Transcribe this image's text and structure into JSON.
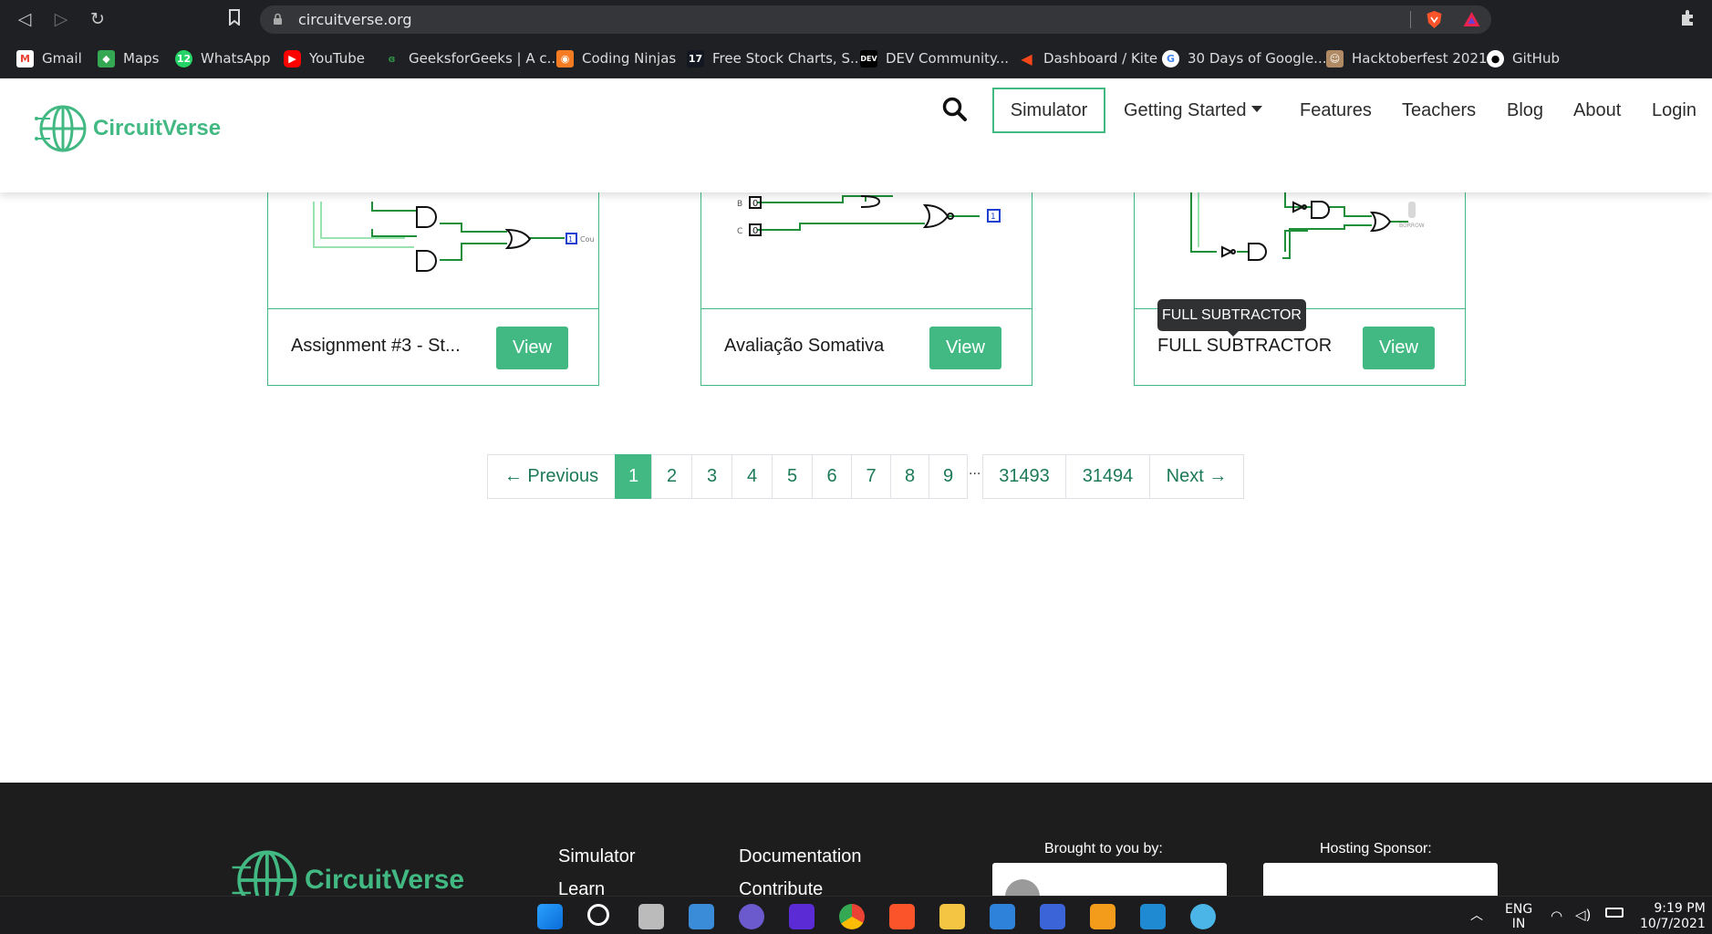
{
  "browser": {
    "url": "circuitverse.org",
    "bookmarks": [
      {
        "label": "Gmail",
        "icon": "gmail-icon",
        "color": "#ea4335"
      },
      {
        "label": "Maps",
        "icon": "maps-icon",
        "color": "#34a853"
      },
      {
        "label": "WhatsApp",
        "icon": "whatsapp-icon",
        "color": "#25d366"
      },
      {
        "label": "YouTube",
        "icon": "youtube-icon",
        "color": "#ff0000"
      },
      {
        "label": "GeeksforGeeks | A c...",
        "icon": "geeksforgeeks-icon",
        "color": "#2f8d46"
      },
      {
        "label": "Coding Ninjas",
        "icon": "codingninjas-icon",
        "color": "#f57c22"
      },
      {
        "label": "Free Stock Charts, S...",
        "icon": "tradingview-icon",
        "color": "#000000"
      },
      {
        "label": "DEV Community...",
        "icon": "dev-icon",
        "color": "#000000"
      },
      {
        "label": "Dashboard / Kite",
        "icon": "kite-icon",
        "color": "#f6461a"
      },
      {
        "label": "30 Days of Google...",
        "icon": "google-icon",
        "color": "#ffffff"
      },
      {
        "label": "Hacktoberfest 2021",
        "icon": "hacktoberfest-icon",
        "color": "#b08a64"
      },
      {
        "label": "GitHub",
        "icon": "github-icon",
        "color": "#ffffff"
      }
    ]
  },
  "site": {
    "brand": "CircuitVerse",
    "brand_color": "#42b983",
    "nav": {
      "simulator": "Simulator",
      "getting_started": "Getting Started",
      "features": "Features",
      "teachers": "Teachers",
      "blog": "Blog",
      "about": "About",
      "login": "Login"
    }
  },
  "cards": [
    {
      "title": "Assignment #3 - St...",
      "view": "View",
      "output_label": "1",
      "side_label": "Cou"
    },
    {
      "title": "Avaliação Somativa",
      "view": "View",
      "input_b": "0",
      "input_c": "0",
      "label_b": "B",
      "label_c": "C",
      "output_label": "1"
    },
    {
      "title": "FULL SUBTRACTOR",
      "view": "View",
      "side_label": "BORROW"
    }
  ],
  "tooltip": "FULL SUBTRACTOR",
  "pagination": {
    "previous": "← Previous",
    "pages": [
      "1",
      "2",
      "3",
      "4",
      "5",
      "6",
      "7",
      "8",
      "9"
    ],
    "active": "1",
    "gap": "...",
    "last_pages": [
      "31493",
      "31494"
    ],
    "next": "Next →"
  },
  "footer": {
    "links_col1": [
      "Simulator",
      "Learn"
    ],
    "links_col2": [
      "Documentation",
      "Contribute"
    ],
    "brought_to_you_by": "Brought to you by:",
    "hosting_sponsor": "Hosting Sponsor:"
  },
  "taskbar": {
    "lang": "ENG",
    "region": "IN",
    "time": "9:19 PM",
    "date": "10/7/2021"
  }
}
